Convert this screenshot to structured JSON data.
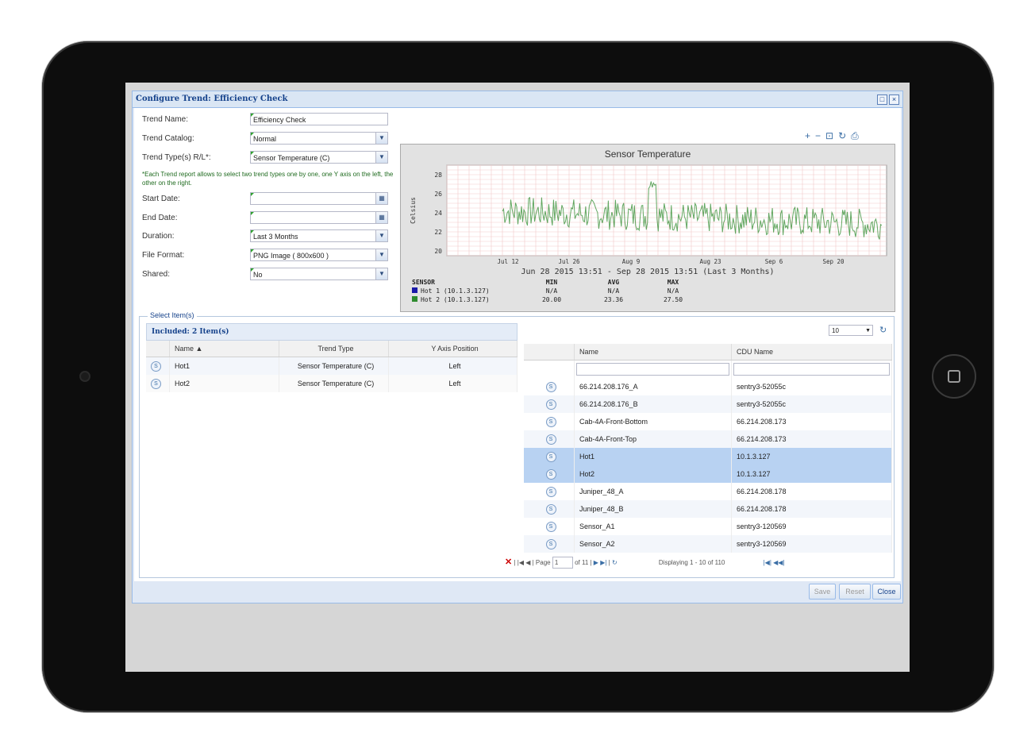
{
  "window": {
    "title": "Configure Trend: Efficiency Check"
  },
  "form": {
    "trend_name": {
      "label": "Trend Name:",
      "value": "Efficiency Check"
    },
    "trend_catalog": {
      "label": "Trend Catalog:",
      "value": "Normal"
    },
    "trend_type": {
      "label": "Trend Type(s) R/L*:",
      "value": "Sensor Temperature (C)"
    },
    "note": "*Each Trend report allows to select two trend types one by one, one Y axis on the left, the other on the right.",
    "start_date": {
      "label": "Start Date:",
      "value": ""
    },
    "end_date": {
      "label": "End Date:",
      "value": ""
    },
    "duration": {
      "label": "Duration:",
      "value": "Last 3 Months"
    },
    "file_format": {
      "label": "File Format:",
      "value": "PNG Image ( 800x600 )"
    },
    "shared": {
      "label": "Shared:",
      "value": "No"
    }
  },
  "chart_data": {
    "type": "line",
    "title": "Sensor Temperature",
    "ylabel": "Celsius",
    "ylim": [
      19.5,
      29
    ],
    "yticks": [
      "28",
      "26",
      "24",
      "22",
      "20"
    ],
    "xticks": [
      "Jul 12",
      "Jul 26",
      "Aug 9",
      "Aug 23",
      "Sep 6",
      "Sep 20"
    ],
    "xlabel": "Jun 28 2015 13:51 - Sep 28 2015 13:51 (Last 3 Months)",
    "series": [
      {
        "name": "Hot 1 (10.1.3.127)",
        "color": "#1a1aa8",
        "min": "N/A",
        "avg": "N/A",
        "max": "N/A"
      },
      {
        "name": "Hot 2 (10.1.3.127)",
        "color": "#2e8b2e",
        "min": "20.00",
        "avg": "23.36",
        "max": "27.50"
      }
    ],
    "stats_headers": [
      "SENSOR",
      "MIN",
      "AVG",
      "MAX"
    ]
  },
  "select_items": {
    "legend": "Select Item(s)",
    "included_title": "Included: 2 Item(s)",
    "included_columns": [
      "Name ▲",
      "Trend Type",
      "Y Axis Position"
    ],
    "included_rows": [
      {
        "name": "Hot1",
        "type": "Sensor Temperature (C)",
        "axis": "Left"
      },
      {
        "name": "Hot2",
        "type": "Sensor Temperature (C)",
        "axis": "Left"
      }
    ],
    "page_size": "10",
    "available_columns": [
      "Name",
      "CDU Name"
    ],
    "available_rows": [
      {
        "name": "66.214.208.176_A",
        "cdu": "sentry3-52055c"
      },
      {
        "name": "66.214.208.176_B",
        "cdu": "sentry3-52055c"
      },
      {
        "name": "Cab-4A-Front-Bottom",
        "cdu": "66.214.208.173"
      },
      {
        "name": "Cab-4A-Front-Top",
        "cdu": "66.214.208.173"
      },
      {
        "name": "Hot1",
        "cdu": "10.1.3.127"
      },
      {
        "name": "Hot2",
        "cdu": "10.1.3.127"
      },
      {
        "name": "Juniper_48_A",
        "cdu": "66.214.208.178"
      },
      {
        "name": "Juniper_48_B",
        "cdu": "66.214.208.178"
      },
      {
        "name": "Sensor_A1",
        "cdu": "sentry3-120569"
      },
      {
        "name": "Sensor_A2",
        "cdu": "sentry3-120569"
      }
    ],
    "pager": {
      "page_label": "Page",
      "page": "1",
      "of": "of 11",
      "displaying": "Displaying 1 - 10 of 110"
    }
  },
  "buttons": {
    "save": "Save",
    "reset": "Reset",
    "close": "Close"
  }
}
